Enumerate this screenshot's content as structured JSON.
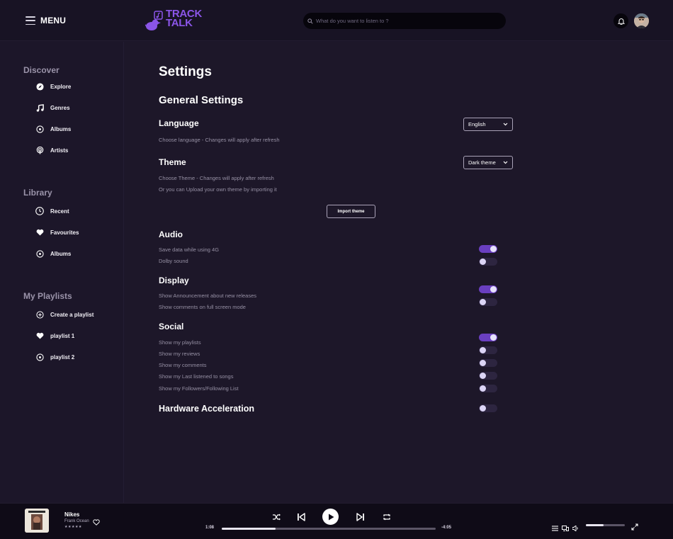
{
  "header": {
    "menu_label": "MENU",
    "logo_line1": "TRACK",
    "logo_line2": "TALK",
    "search_placeholder": "What do you want to listen to ?"
  },
  "sidebar": {
    "discover_title": "Discover",
    "discover_items": [
      {
        "label": "Explore",
        "icon": "compass-icon"
      },
      {
        "label": "Genres",
        "icon": "music-note-icon"
      },
      {
        "label": "Albums",
        "icon": "disc-icon"
      },
      {
        "label": "Artists",
        "icon": "podcast-icon"
      }
    ],
    "library_title": "Library",
    "library_items": [
      {
        "label": "Recent",
        "icon": "clock-icon"
      },
      {
        "label": "Favourites",
        "icon": "heart-icon"
      },
      {
        "label": "Albums",
        "icon": "disc-icon"
      }
    ],
    "playlists_title": "My Playlists",
    "playlist_items": [
      {
        "label": "Create a playlist",
        "icon": "plus-circle-icon"
      },
      {
        "label": "playlist 1",
        "icon": "heart-icon"
      },
      {
        "label": "playlist 2",
        "icon": "disc-icon"
      }
    ]
  },
  "settings": {
    "title": "Settings",
    "general_title": "General Settings",
    "language": {
      "title": "Language",
      "description": "Choose language - Changes will apply after refresh",
      "selected": "English"
    },
    "theme": {
      "title": "Theme",
      "description": "Choose Theme - Changes will apply after refresh",
      "description2": "Or you can Upload your own theme by importing it",
      "selected": "Dark theme",
      "import_label": "Import theme"
    },
    "audio": {
      "title": "Audio",
      "options": [
        {
          "label": "Save data while using 4G",
          "on": true
        },
        {
          "label": "Dolby sound",
          "on": false
        }
      ]
    },
    "display": {
      "title": "Display",
      "options": [
        {
          "label": "Show Announcement about new releases",
          "on": true
        },
        {
          "label": "Show comments on full screen mode",
          "on": false
        }
      ]
    },
    "social": {
      "title": "Social",
      "options": [
        {
          "label": "Show my playlists",
          "on": true
        },
        {
          "label": "Show my reviews",
          "on": false
        },
        {
          "label": "Show my comments",
          "on": false
        },
        {
          "label": "Show my Last listened to songs",
          "on": false
        },
        {
          "label": "Show my Followers/Following List",
          "on": false
        }
      ]
    },
    "hardware": {
      "title": "Hardware Acceleration",
      "on": false
    }
  },
  "player": {
    "title": "Nikes",
    "artist": "Frank Ocean",
    "rating": "★★★★★",
    "elapsed": "1:08",
    "remaining": "-4:05",
    "progress_fraction": 0.25,
    "volume_fraction": 0.45
  },
  "colors": {
    "accent": "#6a3fc0",
    "logo": "#8b55e8",
    "background": "#1d1729"
  }
}
